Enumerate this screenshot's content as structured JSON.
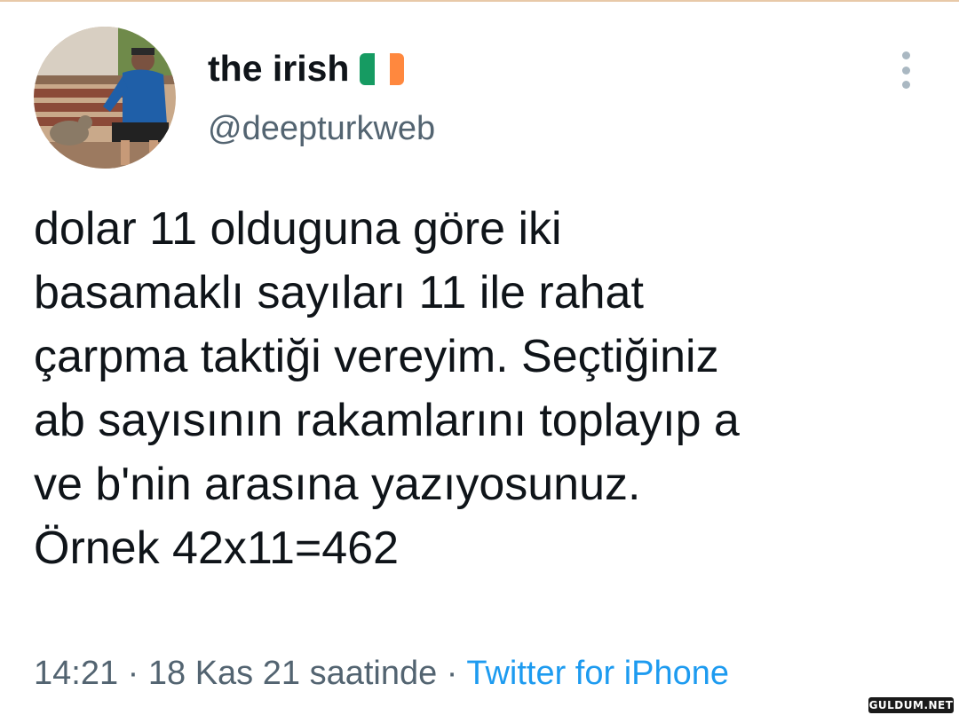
{
  "header": {
    "display_name": "the irish",
    "flag_icon": "ireland-flag-icon",
    "flag_colors": [
      "#169b62",
      "#ffffff",
      "#ff883e"
    ],
    "handle": "@deepturkweb",
    "more_icon": "more-vertical-icon"
  },
  "tweet": {
    "lines": [
      "dolar 11 olduguna göre iki",
      "basamaklı sayıları 11 ile rahat",
      "çarpma taktiği vereyim. Seçtiğiniz",
      "ab sayısının rakamlarını toplayıp a",
      "ve b'nin arasına yazıyosunuz.",
      "Örnek 42x11=462"
    ]
  },
  "meta": {
    "time": "14:21",
    "separator": " · ",
    "date": "18 Kas 21 saatinde",
    "source": "Twitter for iPhone"
  },
  "watermark": {
    "text": "GULDUM.NET"
  },
  "colors": {
    "text": "#0f1419",
    "secondary": "#536471",
    "link": "#1d9bf0"
  }
}
